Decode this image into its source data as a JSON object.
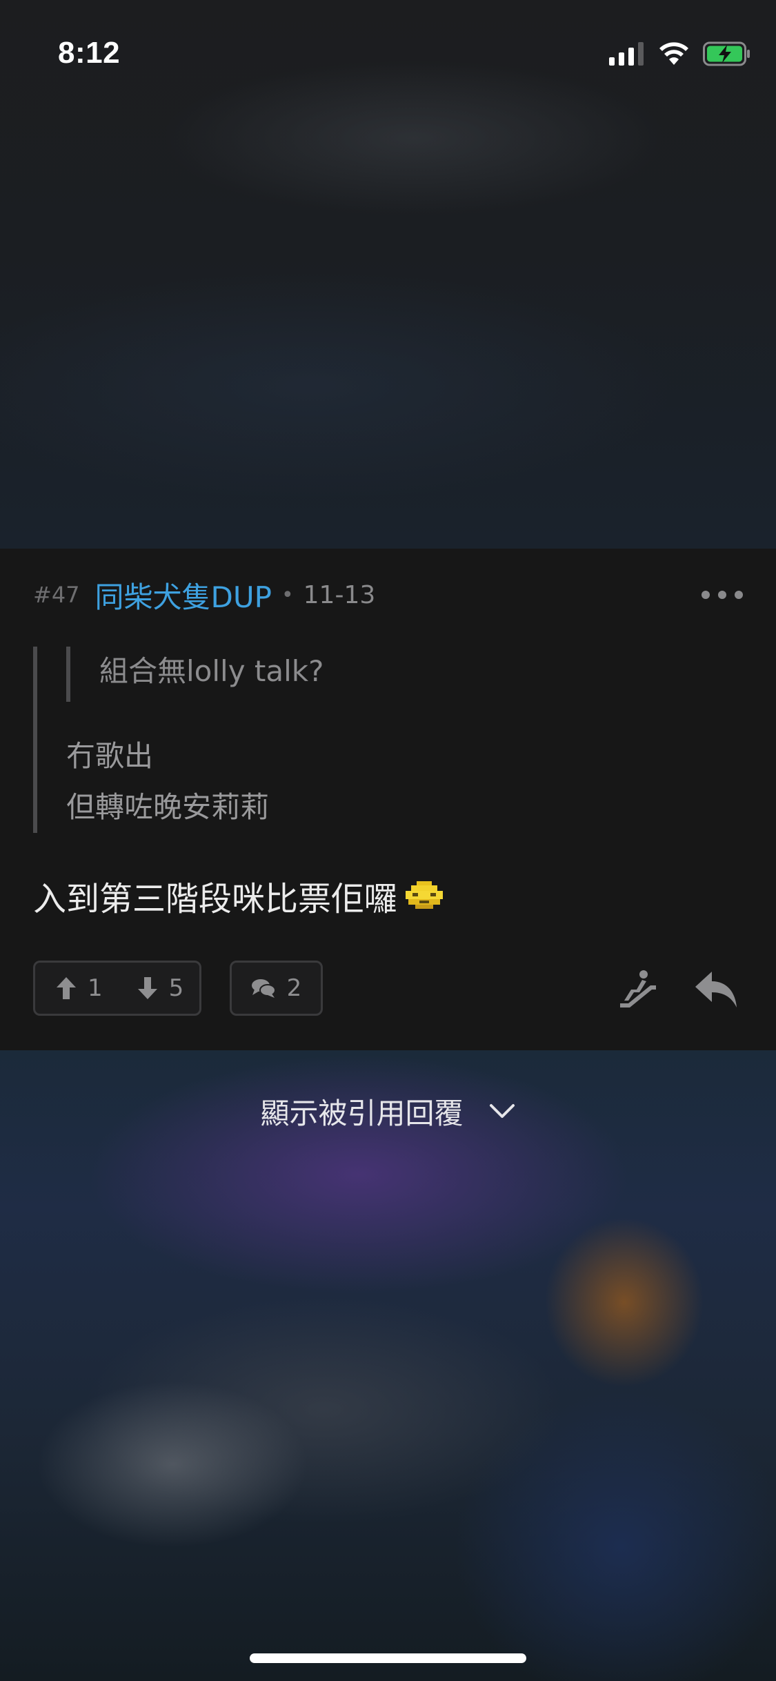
{
  "status_bar": {
    "time": "8:12"
  },
  "post": {
    "number": "#47",
    "author": "同柴犬隻DUP",
    "separator": "•",
    "date": "11-13",
    "nested_quote": "組合無lolly talk?",
    "quote_lines": [
      "冇歌出",
      "但轉咗晚安莉莉"
    ],
    "content": "入到第三階段咪比票佢囉",
    "upvotes": "1",
    "downvotes": "5",
    "comments": "2",
    "colors": {
      "author": "#3ea1e0",
      "card_background": "#171717"
    }
  },
  "show_quoted_label": "顯示被引用回覆",
  "icons": {
    "signal": "cellular-signal-icon",
    "wifi": "wifi-icon",
    "battery": "battery-charging-icon",
    "more": "more-dots-icon",
    "upvote": "arrow-up-icon",
    "downvote": "arrow-down-icon",
    "comment": "comment-bubbles-icon",
    "escalator": "escalator-icon",
    "reply": "reply-arrow-icon",
    "chevron": "chevron-down-icon",
    "emoji": "pixel-emoji-icon"
  }
}
